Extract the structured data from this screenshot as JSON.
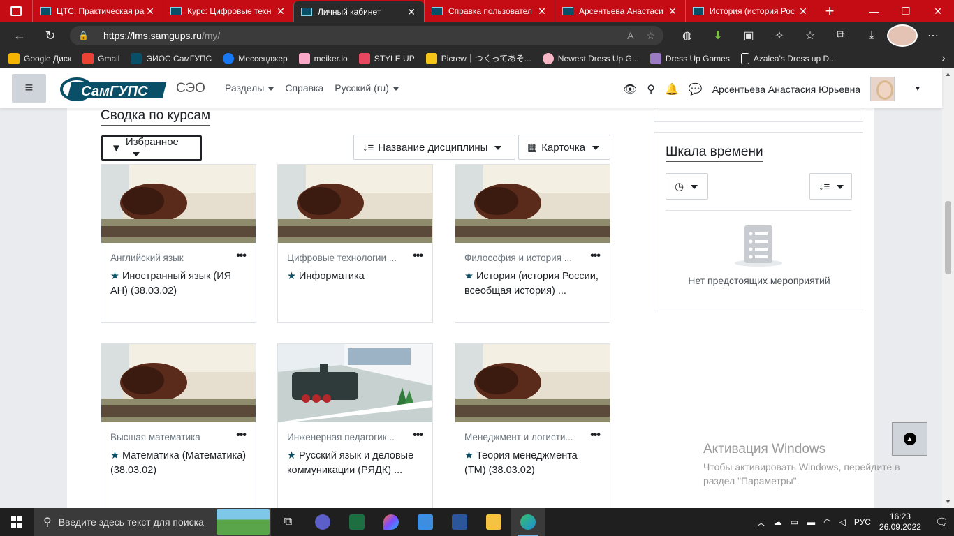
{
  "browser": {
    "tabs": [
      {
        "label": "ЦТС: Практическая ра",
        "active": false
      },
      {
        "label": "Курс: Цифровые техн",
        "active": false
      },
      {
        "label": "Личный кабинет",
        "active": true
      },
      {
        "label": "Справка пользовател",
        "active": false
      },
      {
        "label": "Арсентьева Анастаси",
        "active": false
      },
      {
        "label": "История (история Рос",
        "active": false
      }
    ],
    "url_host": "https://lms.samgups.ru",
    "url_path": "/my/",
    "bookmarks": [
      {
        "label": "Google Диск",
        "color": "#f4b400"
      },
      {
        "label": "Gmail",
        "color": "#ea4335"
      },
      {
        "label": "ЭИОС СамГУПС",
        "color": "#0a4f68"
      },
      {
        "label": "Мессенджер",
        "color": "#1877f2"
      },
      {
        "label": "meiker.io",
        "color": "#f9a8c8"
      },
      {
        "label": "STYLE UP",
        "color": "#e8475f"
      },
      {
        "label": "Picrew｜つくってあそ...",
        "color": "#f5c518"
      },
      {
        "label": "Newest Dress Up G...",
        "color": "#f6b7c7"
      },
      {
        "label": "Dress Up Games",
        "color": "#9b7cc4"
      },
      {
        "label": "Azalea's Dress up D...",
        "color": "#ffffff"
      }
    ]
  },
  "navbar": {
    "site_name": "СЭО",
    "menu": [
      "Разделы",
      "Справка",
      "Русский (ru)"
    ],
    "user_name": "Арсентьева Анастасия Юрьевна",
    "logo_text": "СамГУПС"
  },
  "main": {
    "section_title": "Сводка по курсам",
    "filter_label": "Избранное",
    "sort_label": "Название дисциплины",
    "view_label": "Карточка",
    "courses": [
      {
        "category": "Английский язык",
        "name": "Иностранный язык (ИЯ АН) (38.03.02)",
        "image": "sepia"
      },
      {
        "category": "Цифровые технологии ...",
        "name": "Информатика",
        "image": "sepia"
      },
      {
        "category": "Философия и история ...",
        "name": "История (история России, всеобщая история) ...",
        "image": "sepia"
      },
      {
        "category": "Высшая математика",
        "name": "Математика (Математика) (38.03.02)",
        "image": "sepia"
      },
      {
        "category": "Инженерная педагогик...",
        "name": "Русский язык и деловые коммуникации (РЯДК) ...",
        "image": "loco"
      },
      {
        "category": "Менеджмент и логисти...",
        "name": "Теория менеджмента (ТМ) (38.03.02)",
        "image": "sepia"
      }
    ]
  },
  "timeline": {
    "title": "Шкала времени",
    "empty_text": "Нет предстоящих мероприятий"
  },
  "activation": {
    "title": "Активация Windows",
    "line1": "Чтобы активировать Windows, перейдите в",
    "line2": "раздел \"Параметры\"."
  },
  "taskbar": {
    "search_placeholder": "Введите здесь текст для поиска",
    "lang": "РУС",
    "time": "16:23",
    "date": "26.09.2022"
  }
}
